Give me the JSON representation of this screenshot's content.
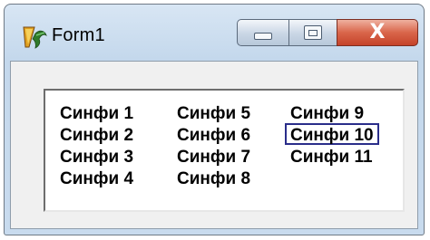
{
  "window": {
    "title": "Form1",
    "icon": "delphi-app-icon"
  },
  "titlebar_buttons": {
    "minimize": "minimize-icon",
    "maximize": "maximize-icon",
    "close": "close-icon",
    "close_glyph": "X"
  },
  "listbox": {
    "columns": [
      [
        "Синфи 1",
        "Синфи 2",
        "Синфи 3",
        "Синфи 4"
      ],
      [
        "Синфи 5",
        "Синфи 6",
        "Синфи 7",
        "Синфи 8"
      ],
      [
        "Синфи 9",
        "Синфи 10",
        "Синфи 11"
      ]
    ],
    "focused_item": "Синфи 10"
  }
}
